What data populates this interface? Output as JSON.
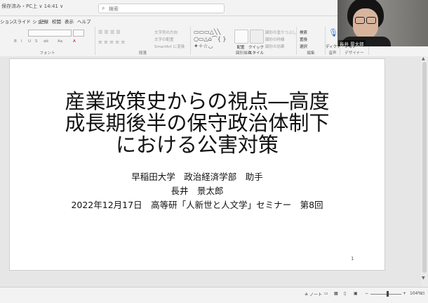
{
  "app": {
    "filename": "保存済み・PC上 ∨ 14:41 ∨",
    "search_placeholder": "検索"
  },
  "tabs": [
    {
      "label": "ション"
    },
    {
      "label": "スライド ショー"
    },
    {
      "label": "記録"
    },
    {
      "label": "校閲"
    },
    {
      "label": "表示"
    },
    {
      "label": "ヘルプ"
    }
  ],
  "ribbon": {
    "groups": [
      {
        "label": "フォント"
      },
      {
        "label": "段落"
      },
      {
        "label": "図形描画"
      },
      {
        "label": "編集"
      },
      {
        "label": "音声"
      },
      {
        "label": "デザイナー"
      }
    ],
    "buttons": {
      "text_direction": "文字列の方向",
      "text_align": "文字の配置",
      "smartart": "SmartArt に変換",
      "arrange": "配置",
      "quick_styles": "クイック スタイル",
      "shape_fill": "図形の塗りつぶし",
      "shape_outline": "図形の枠線",
      "shape_effects": "図形の効果",
      "find": "検索",
      "replace": "置換",
      "select": "選択",
      "dictate": "ディクテーション",
      "designer": "デザイナー"
    }
  },
  "webcam": {
    "name": "長井 景太郎"
  },
  "slide": {
    "title_lines": [
      "産業政策史からの視点―高度",
      "成長期後半の保守政治体制下",
      "における公害対策"
    ],
    "subtitle_lines": [
      "早稲田大学　政治経済学部　助手",
      "長井　景太郎",
      "2022年12月17日　高等研「人新世と人文学」セミナー　第8回"
    ],
    "slide_number": "1"
  },
  "status": {
    "notes_label": "ノート",
    "zoom": "104%"
  }
}
